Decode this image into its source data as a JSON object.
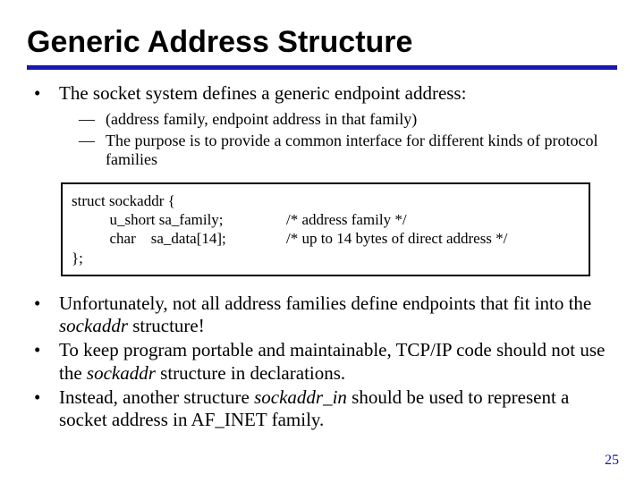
{
  "title": "Generic Address Structure",
  "bullet1": "The socket system defines a generic endpoint address:",
  "sub1": "(address family, endpoint address in that family)",
  "sub2": "The purpose is to provide a common interface for different kinds of protocol families",
  "code": {
    "l1": "struct sockaddr {",
    "l2a": "          u_short sa_family;",
    "l2b": "/* address family */",
    "l3a": "          char    sa_data[14];",
    "l3b": "/* up to 14 bytes of direct address */",
    "l4": "};"
  },
  "b2a_pre": "Unfortunately, not all address families define endpoints that fit into the ",
  "b2a_it": "sockaddr",
  "b2a_post": " structure!",
  "b2b_pre": "To keep program portable and maintainable, TCP/IP code should not use the ",
  "b2b_it": "sockaddr",
  "b2b_post": " structure in declarations.",
  "b2c_pre": "Instead, another structure ",
  "b2c_it": "sockaddr_in",
  "b2c_post": " should be used to represent a socket address in AF_INET family.",
  "page": "25"
}
